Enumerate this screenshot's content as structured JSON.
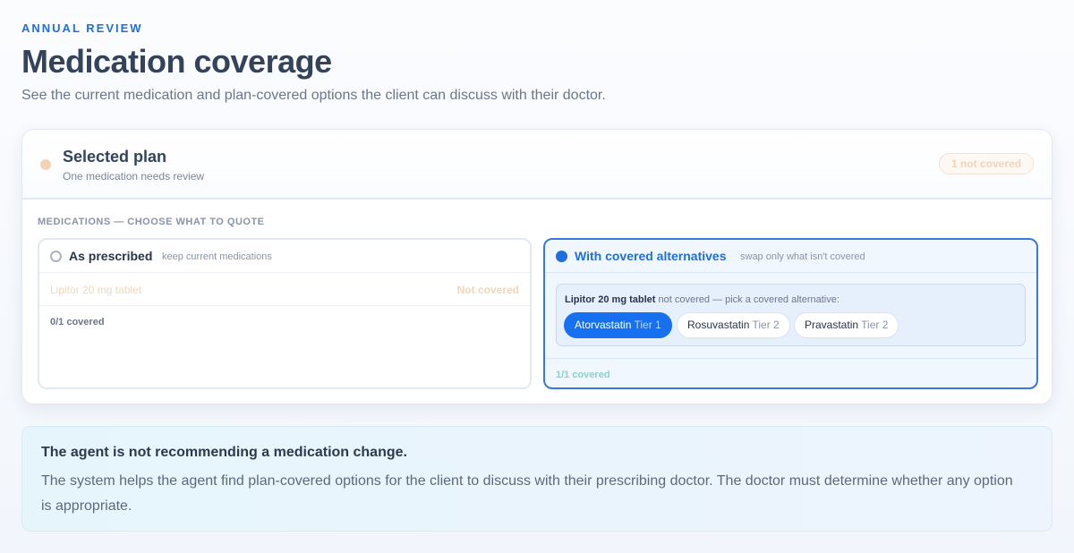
{
  "header": {
    "eyebrow": "ANNUAL REVIEW",
    "title": "Medication coverage",
    "subtitle": "See the current medication and plan-covered options the client can discuss with their doctor."
  },
  "plan": {
    "title": "Selected plan",
    "subtitle": "One medication needs review",
    "badge": "1 not covered",
    "status_color": "#f1d4b4"
  },
  "medications": {
    "section_label": "MEDICATIONS — CHOOSE WHAT TO QUOTE",
    "options": [
      {
        "title": "As prescribed",
        "hint": "keep current medications",
        "selected": false,
        "rows": [
          {
            "name": "Lipitor 20 mg tablet",
            "status": "Not covered"
          }
        ],
        "count": "0/1 covered"
      },
      {
        "title": "With covered alternatives",
        "hint": "swap only what isn't covered",
        "selected": true,
        "alt_drug": "Lipitor 20 mg tablet",
        "alt_note": "not covered — pick a covered alternative:",
        "alternatives": [
          {
            "name": "Atorvastatin",
            "tier": "Tier 1",
            "selected": true
          },
          {
            "name": "Rosuvastatin",
            "tier": "Tier 2",
            "selected": false
          },
          {
            "name": "Pravastatin",
            "tier": "Tier 2",
            "selected": false
          }
        ],
        "count": "1/1 covered"
      }
    ]
  },
  "notice": {
    "title": "The agent is not recommending a medication change.",
    "body": "The system helps the agent find plan-covered options for the client to discuss with their prescribing doctor. The doctor must determine whether any option is appropriate."
  },
  "colors": {
    "accent": "#1f6fe0",
    "selected_pill": "#1670f0",
    "warning": "#f0d6bc"
  }
}
